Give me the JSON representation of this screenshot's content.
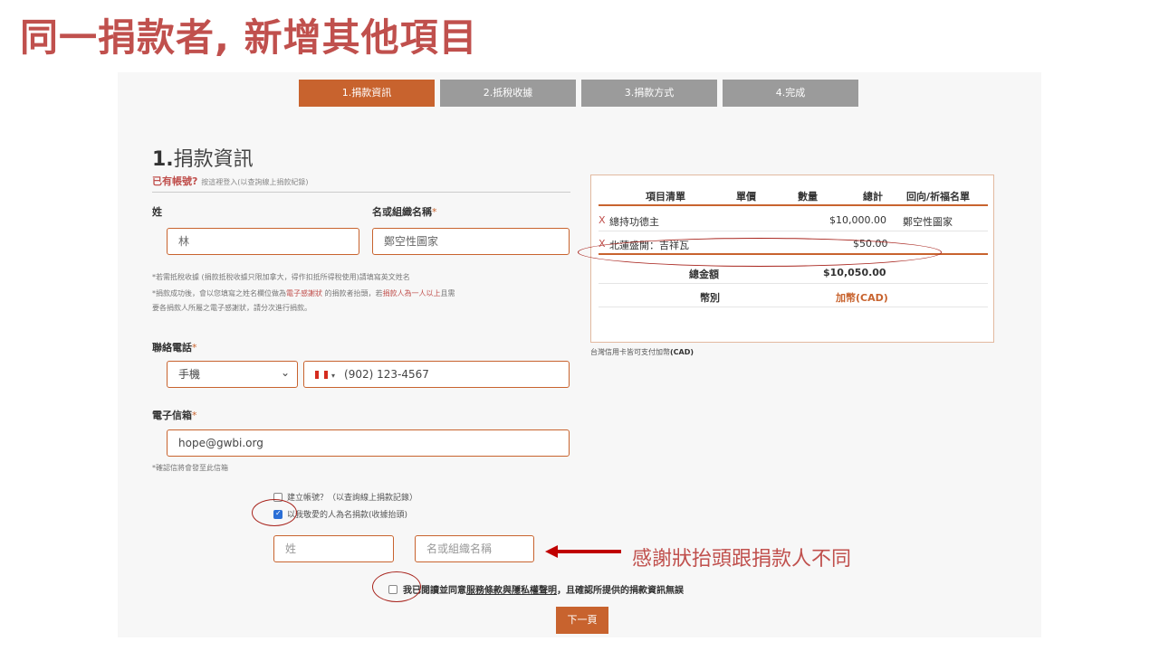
{
  "slide_title": "同一捐款者, 新增其他項目",
  "steps": [
    "1.捐款資訊",
    "2.抵稅收據",
    "3.捐款方式",
    "4.完成"
  ],
  "section": {
    "num": "1.",
    "title": "捐款資訊"
  },
  "login": {
    "label": "已有帳號?",
    "hint": "按這裡登入(以查詢線上捐款紀錄)"
  },
  "name": {
    "last_label": "姓",
    "first_label": "名或組織名稱",
    "req": "*",
    "last_value": "林",
    "first_value": "鄭空性圖家"
  },
  "notes": {
    "n1": "*若需抵稅收據 (捐款抵稅收據只限加拿大，得作扣抵所得稅使用)請填寫英文姓名",
    "n2a": "*捐款成功後，會以您填寫之姓名欄位做為",
    "n2b": "電子感謝狀",
    "n2c": " 的捐款者抬頭，若",
    "n2d": "捐款人為一人以上",
    "n2e": "且需",
    "n3": "要各捐款人所屬之電子感謝狀，請分次進行捐款。"
  },
  "phone": {
    "label": "聯絡電話",
    "req": "*",
    "type_value": "手機",
    "flag_caret": "▾",
    "number": "(902) 123-4567",
    "select_caret": "⌄"
  },
  "email": {
    "label": "電子信箱",
    "req": "*",
    "value": "hope@gwbi.org",
    "note": "*確認信將會發至此信箱"
  },
  "checks": {
    "create_account": "建立帳號？（以查詢線上捐款記錄）",
    "honor": "以我敬愛的人為名捐款(收據抬頭)"
  },
  "honor_fields": {
    "last_placeholder": "姓",
    "first_placeholder": "名或組織名稱"
  },
  "annotation": "感謝狀抬頭跟捐款人不同",
  "agree": {
    "a": "我已閱讀並同意",
    "terms": "服務條款與隱私權聲明",
    "b": "，且確認所提供的捐款資訊無誤"
  },
  "next_label": "下一頁",
  "summary": {
    "headers": [
      "項目清單",
      "單價",
      "數量",
      "總計",
      "回向/祈福名單"
    ],
    "items": [
      {
        "mark": "X",
        "name": "總持功德主",
        "total": "$10,000.00",
        "dedication": "鄭空性圖家"
      },
      {
        "mark": "X",
        "name": "北蓮盛開：吉祥瓦",
        "total": "$50.00",
        "dedication": ""
      }
    ],
    "total_label": "總金額",
    "total_value": "$10,050.00",
    "currency_label": "幣別",
    "currency_value": "加幣(CAD)"
  },
  "cad_note": {
    "a": "台灣信用卡皆可支付加幣",
    "b": "(CAD)"
  },
  "colors": {
    "accent": "#c8632e",
    "annotation": "#c0504d",
    "step_inactive": "#9b9b9b"
  }
}
